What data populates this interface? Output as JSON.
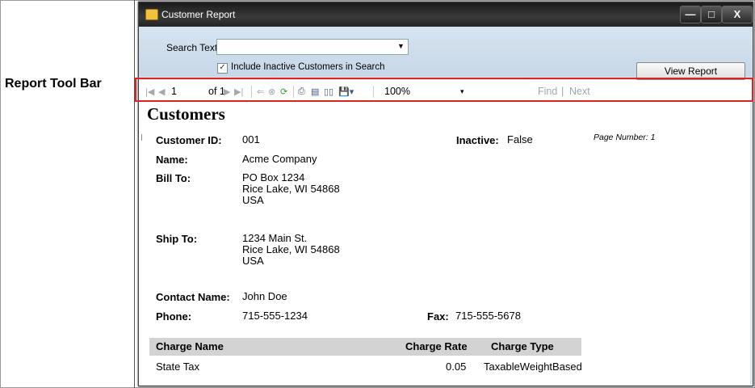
{
  "callout": "Report Tool Bar",
  "window": {
    "title": "Customer Report",
    "minimize": "—",
    "maximize": "□",
    "close": "X"
  },
  "search": {
    "label": "Search Text",
    "value": "",
    "include_inactive_checked": true,
    "include_inactive_label": "Include Inactive Customers in Search",
    "view_report": "View Report"
  },
  "toolbar": {
    "page_current": "1",
    "page_of": "of 1",
    "zoom": "100%",
    "find": "Find",
    "separator": "|",
    "next": "Next"
  },
  "report": {
    "title": "Customers",
    "customer_id_label": "Customer ID:",
    "customer_id": "001",
    "inactive_label": "Inactive:",
    "inactive": "False",
    "page_number": "Page Number: 1",
    "name_label": "Name:",
    "name": "Acme Company",
    "bill_to_label": "Bill To:",
    "bill_to": [
      "PO Box 1234",
      "Rice Lake, WI 54868",
      "USA"
    ],
    "ship_to_label": "Ship To:",
    "ship_to": [
      "1234 Main St.",
      "Rice Lake, WI 54868",
      "USA"
    ],
    "contact_label": "Contact Name:",
    "contact": "John Doe",
    "phone_label": "Phone:",
    "phone": "715-555-1234",
    "fax_label": "Fax:",
    "fax": "715-555-5678",
    "charges": {
      "headers": [
        "Charge Name",
        "Charge Rate",
        "Charge Type"
      ],
      "rows": [
        [
          "State Tax",
          "0.05",
          "TaxableWeightBased"
        ]
      ]
    }
  }
}
